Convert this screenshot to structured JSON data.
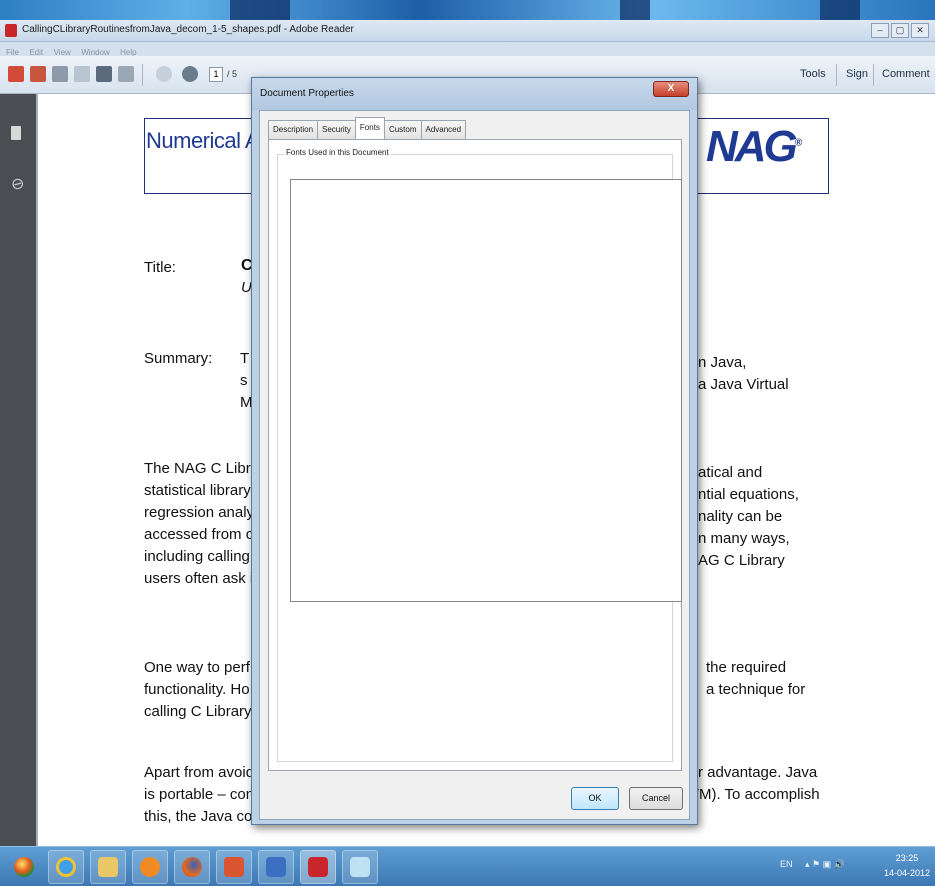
{
  "window": {
    "title": "CallingCLibraryRoutinesfromJava_decom_1-5_shapes.pdf - Adobe Reader",
    "controls": [
      "–",
      "▢",
      "✕"
    ]
  },
  "menubar": {
    "items": [
      "File",
      "Edit",
      "View",
      "Window",
      "Help"
    ]
  },
  "toolbar": {
    "page_current": "1",
    "page_total": "/ 5",
    "tools_label": "Tools",
    "sign_label": "Sign",
    "comment_label": "Comment"
  },
  "document": {
    "header_text": "Numerical A",
    "logo_text": "NAG",
    "logo_mark": "®",
    "title_label": "Title:",
    "title_value_line1": "C",
    "title_value_line2": "U",
    "summary_label": "Summary:",
    "summary_left": [
      "T",
      "s",
      "M"
    ],
    "summary_right": [
      "n Java,",
      "a Java Virtual"
    ],
    "para1_left": [
      "The NAG C Libr",
      "statistical library",
      "regression analy",
      "accessed from c",
      "including calling",
      "users often ask i"
    ],
    "para1_right": [
      "atical and",
      "ntial equations,",
      "nality can be",
      "n many ways,",
      "AG C Library"
    ],
    "para2_left": [
      "One way to perf",
      "functionality. Ho",
      "calling C Library"
    ],
    "para2_right": [
      "the required",
      "a technique for"
    ],
    "para3_left": [
      "Apart from avoid"
    ],
    "para3_right": [
      "r advantage. Java"
    ],
    "para3_full_line2": "is portable – compiled programs run on any machine with a Java Virtual Machine (VM). To accomplish",
    "para3_full_line3": "this, the Java compiler does not compile to a machine-"
  },
  "dialog": {
    "title": "Document Properties",
    "close_label": "X",
    "tabs": [
      "Description",
      "Security",
      "Fonts",
      "Custom",
      "Advanced"
    ],
    "active_tab": "Fonts",
    "group_label": "Fonts Used in this Document",
    "ok_label": "OK",
    "cancel_label": "Cancel"
  },
  "taskbar": {
    "items": [
      "start-orb",
      "internet-explorer",
      "file-explorer",
      "media-player",
      "firefox",
      "powerpoint",
      "word",
      "adobe-reader",
      "notepad"
    ],
    "tray_lang": "EN",
    "tray_icons": "▴ ⚑ ▣ 🔊",
    "clock_time": "23:25",
    "clock_date": "14-04-2012"
  },
  "colors": {
    "accent": "#1f3a93",
    "taskbar": "#4a8ac6",
    "dialog_frame": "#bcd0e6"
  }
}
